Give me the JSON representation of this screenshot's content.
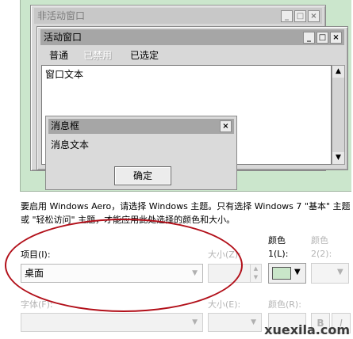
{
  "preview": {
    "inactive_title": "非活动窗口",
    "active_title": "活动窗口",
    "title_buttons": [
      "_",
      "□",
      "×"
    ],
    "menu": {
      "normal": "普通",
      "disabled": "已禁用",
      "selected": "已选定"
    },
    "window_text": "窗口文本",
    "messagebox": {
      "title": "消息框",
      "close": "×",
      "text": "消息文本",
      "ok_button": "确定"
    },
    "scroll_up": "▲",
    "scroll_down": "▼"
  },
  "description": "要启用 Windows Aero，请选择 Windows 主题。只有选择 Windows 7 \"基本\" 主题或 \"轻松访问\" 主题，才能应用此处选择的颜色和大小。",
  "item": {
    "label": "项目(I):",
    "value": "桌面",
    "size_label": "大小(Z):",
    "color1_label": "颜色 1(L):",
    "color1_value": "#c9e6c9",
    "color2_label": "颜色 2(2):"
  },
  "font": {
    "label": "字体(F):",
    "size_label": "大小(E):",
    "color_label": "颜色(R):",
    "bold": "B",
    "italic": "I"
  },
  "watermark": "xuexila.com"
}
